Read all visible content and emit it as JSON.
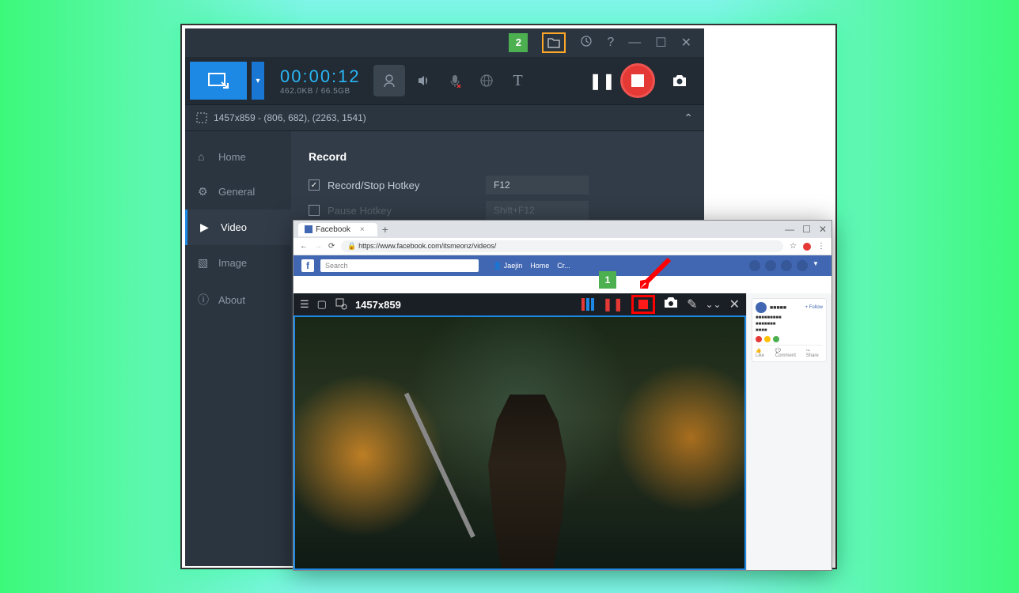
{
  "recorder": {
    "titlebar": {
      "marker": "2"
    },
    "timer": {
      "time": "00:00:12",
      "size": "462.0KB / 66.5GB"
    },
    "region": "1457x859 - (806, 682), (2263, 1541)",
    "sidebar": {
      "items": [
        {
          "label": "Home"
        },
        {
          "label": "General"
        },
        {
          "label": "Video"
        },
        {
          "label": "Image"
        },
        {
          "label": "About"
        }
      ]
    },
    "settings": {
      "heading": "Record",
      "rows": [
        {
          "label": "Record/Stop Hotkey",
          "value": "F12",
          "checked": true
        },
        {
          "label": "Pause Hotkey",
          "value": "Shift+F12",
          "checked": false
        }
      ]
    }
  },
  "browser": {
    "tab": "Facebook",
    "url": "https://www.facebook.com/itsmeonz/videos/",
    "fb": {
      "search_placeholder": "Search",
      "nav": [
        "Jaejin",
        "Home",
        "Cr..."
      ]
    },
    "marker": "1",
    "capture": {
      "resolution": "1457x859"
    },
    "sidebar_post": {
      "actions": [
        "Like",
        "Comment",
        "Share"
      ]
    }
  }
}
